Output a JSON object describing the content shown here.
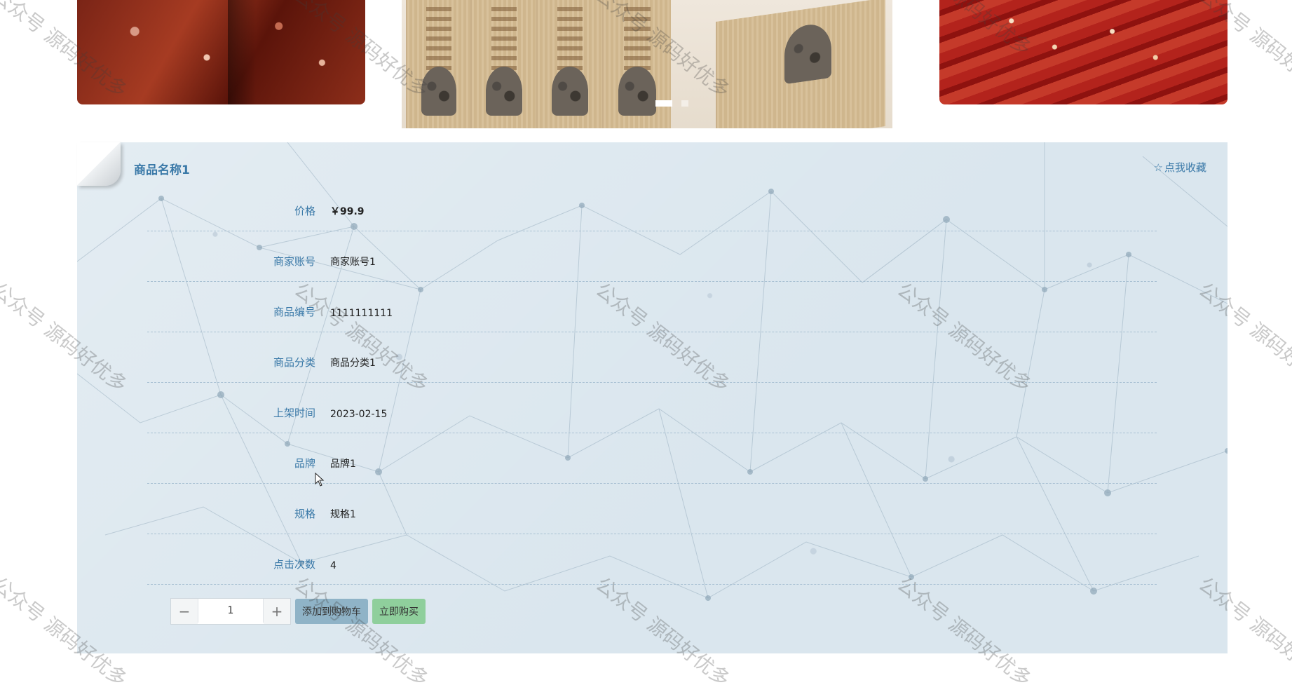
{
  "product": {
    "name": "商品名称1",
    "favorite_label": "点我收藏",
    "favorite_icon": "star-outline-icon"
  },
  "details": [
    {
      "label": "价格",
      "value": "￥99.9"
    },
    {
      "label": "商家账号",
      "value": "商家账号1"
    },
    {
      "label": "商品编号",
      "value": "1111111111"
    },
    {
      "label": "商品分类",
      "value": "商品分类1"
    },
    {
      "label": "上架时间",
      "value": "2023-02-15"
    },
    {
      "label": "品牌",
      "value": "品牌1"
    },
    {
      "label": "规格",
      "value": "规格1"
    },
    {
      "label": "点击次数",
      "value": "4"
    }
  ],
  "purchase": {
    "quantity": "1",
    "minus_symbol": "−",
    "plus_symbol": "+",
    "add_to_cart_label": "添加到购物车",
    "buy_now_label": "立即购买"
  },
  "watermark": "公众号 源码好优多",
  "colors": {
    "accent": "#3a79a8",
    "panel_bg": "#dae6ee",
    "add_cart_bg": "#8fb3c7",
    "buy_now_bg": "#8fcf9c"
  }
}
